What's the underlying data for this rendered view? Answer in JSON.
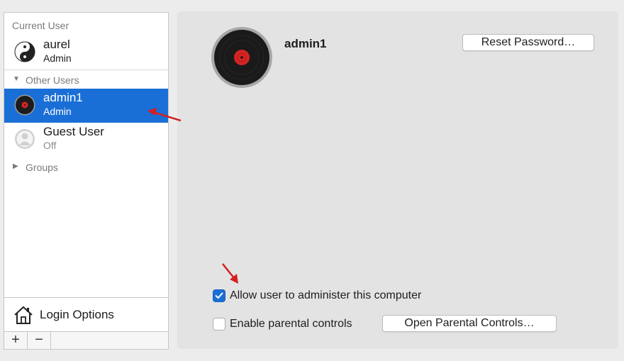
{
  "sidebar": {
    "current_user_header": "Current User",
    "current_user": {
      "name": "aurel",
      "role": "Admin",
      "avatar_icon": "yin-yang-icon"
    },
    "other_users_header": "Other Users",
    "other_users": [
      {
        "name": "admin1",
        "role": "Admin",
        "selected": true,
        "avatar_icon": "vinyl-record-icon"
      },
      {
        "name": "Guest User",
        "role": "Off",
        "selected": false,
        "avatar_icon": "guest-user-icon"
      }
    ],
    "groups_label": "Groups",
    "login_options_label": "Login Options",
    "add_label": "+",
    "remove_label": "−"
  },
  "main": {
    "user_name": "admin1",
    "reset_password_label": "Reset Password…",
    "allow_admin_label": "Allow user to administer this computer",
    "allow_admin_checked": true,
    "parental_controls_label": "Enable parental controls",
    "parental_controls_checked": false,
    "open_parental_label": "Open Parental Controls…"
  },
  "colors": {
    "selection": "#1a6fd6",
    "annotation_arrow": "#d42020"
  }
}
